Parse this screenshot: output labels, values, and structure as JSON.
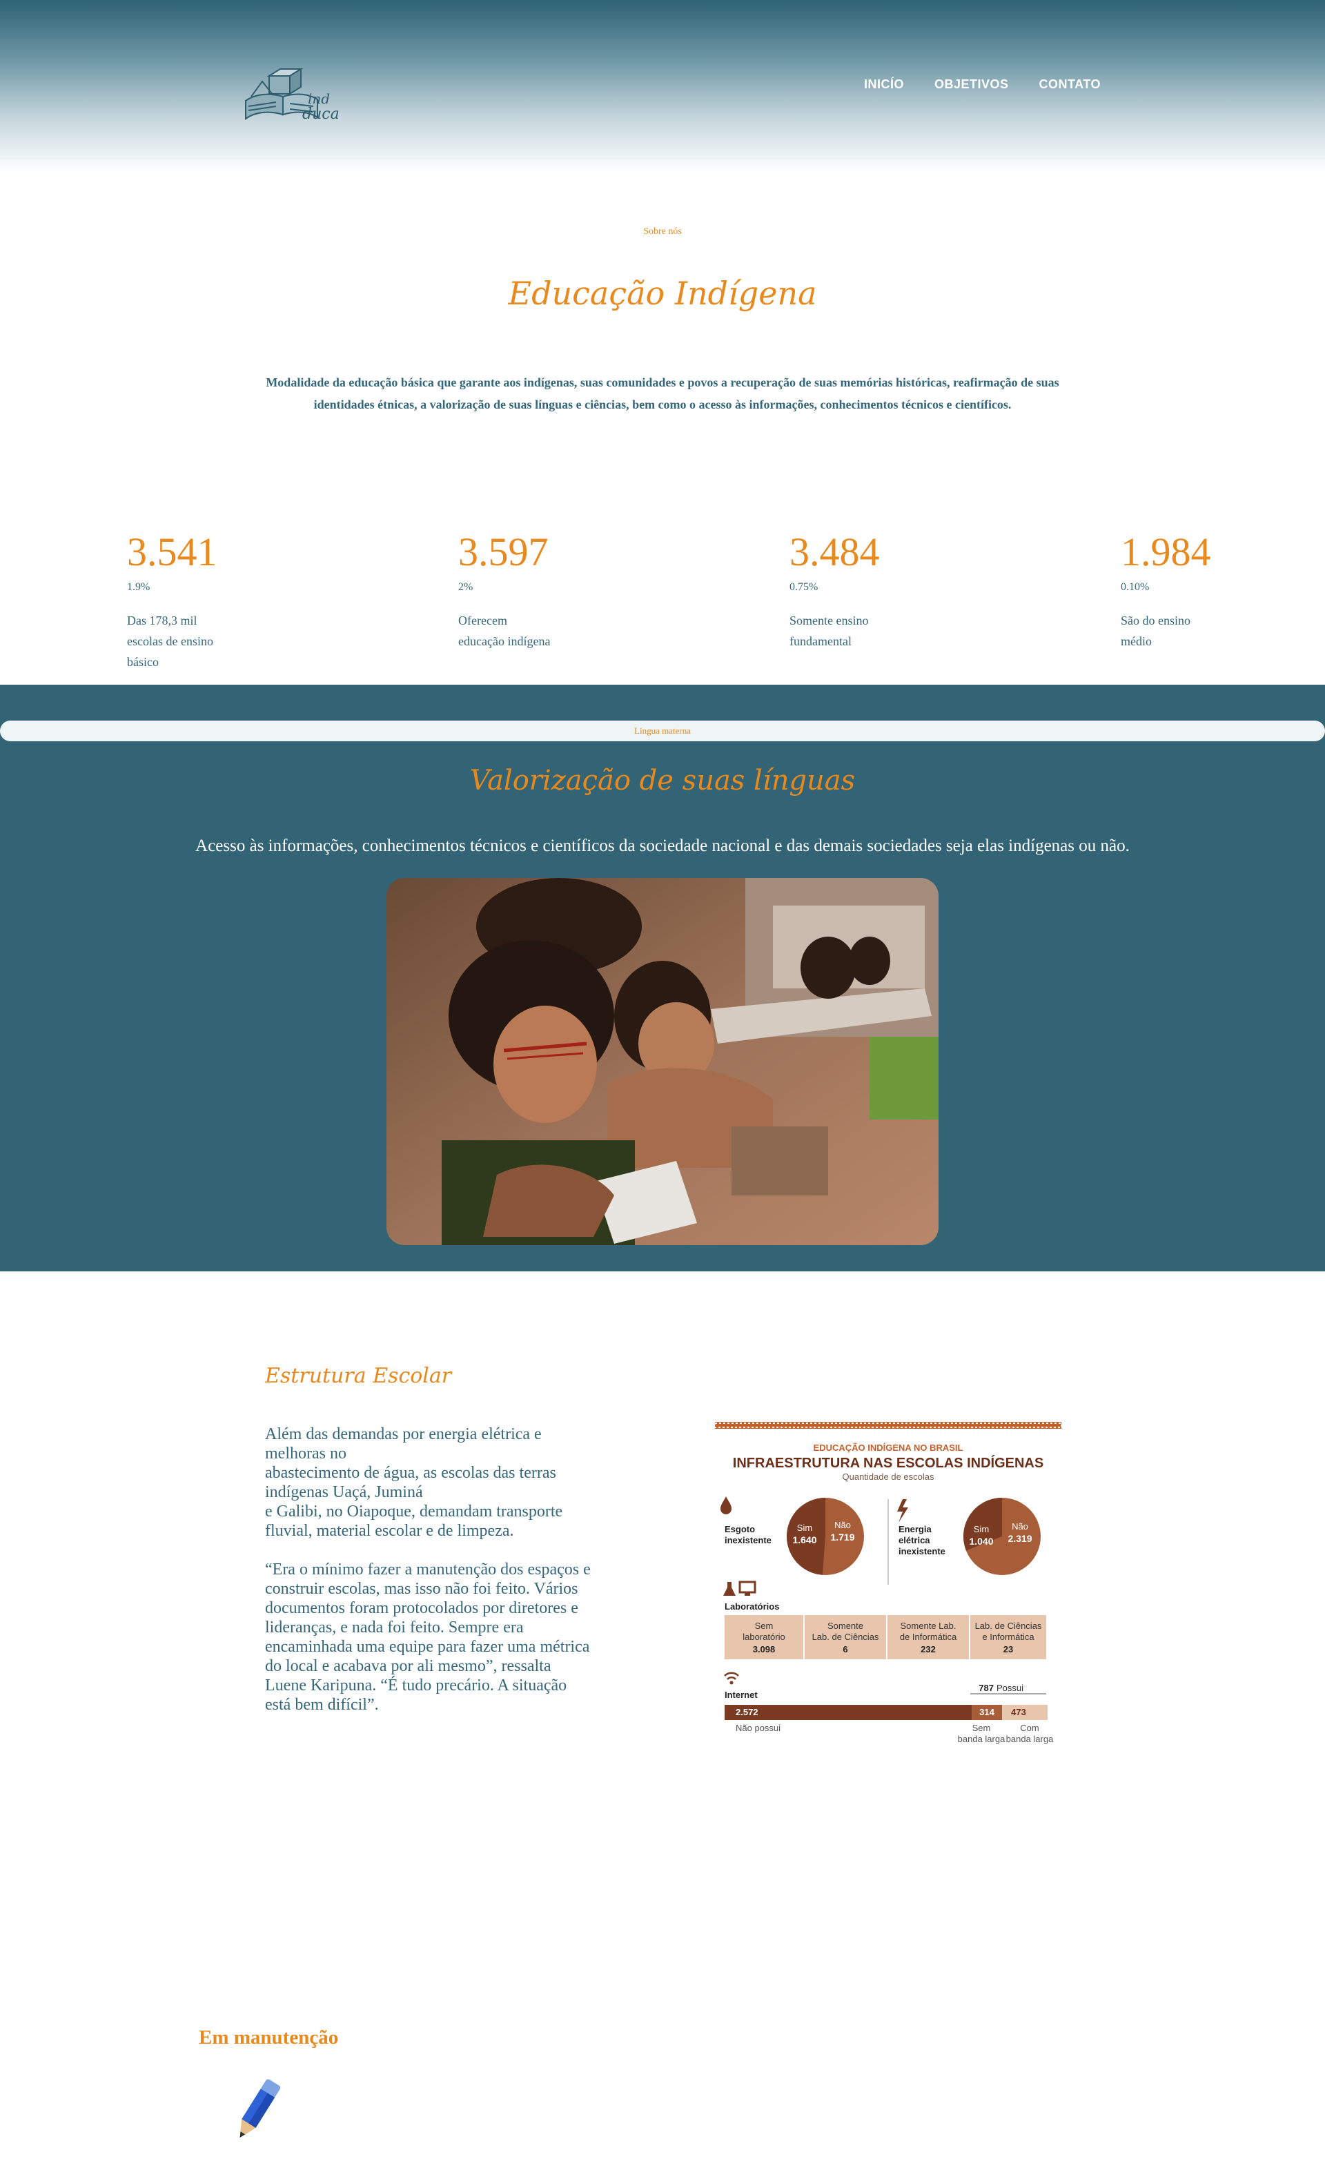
{
  "header": {
    "logo_text": "indeduca",
    "nav": [
      {
        "label": "INICÍO"
      },
      {
        "label": "OBJETIVOS"
      },
      {
        "label": "CONTATO"
      }
    ]
  },
  "about": {
    "eyebrow": "Sobre nós",
    "title": "Educação Indígena",
    "text_line1": "Modalidade da educação básica que garante aos indígenas, suas comunidades e povos a recuperação de suas memórias históricas, reafirmação de suas",
    "text_line2": "identidades étnicas, a valorização de suas línguas e ciências, bem como o acesso às informações, conhecimentos técnicos e científicos."
  },
  "stats": [
    {
      "value": "3.541",
      "pct": "1.9%",
      "desc": [
        "Das 178,3 mil",
        "escolas de ensino",
        "básico"
      ]
    },
    {
      "value": "3.597",
      "pct": "2%",
      "desc": [
        "Oferecem",
        "educação indígena"
      ]
    },
    {
      "value": "3.484",
      "pct": "0.75%",
      "desc": [
        "Somente ensino",
        "fundamental"
      ]
    },
    {
      "value": "1.984",
      "pct": "0.10%",
      "desc": [
        "São do ensino",
        "médio"
      ]
    }
  ],
  "languages": {
    "eyebrow": "Língua materna",
    "title": "Valorização de suas línguas",
    "text": "Acesso às informações, conhecimentos técnicos e científicos da sociedade nacional e das demais sociedades seja elas indígenas ou não."
  },
  "structure": {
    "title": "Estrutura Escolar",
    "p1": [
      "Além das demandas por energia elétrica e",
      "melhoras no",
      "abastecimento de água, as escolas das terras",
      "indígenas Uaçá, Juminá",
      "e Galibi, no Oiapoque, demandam transporte",
      "fluvial, material escolar e de limpeza."
    ],
    "p2": [
      "“Era o mínimo fazer a manutenção dos espaços e",
      "construir escolas, mas isso não foi feito. Vários",
      "documentos foram protocolados por diretores e",
      "lideranças, e nada foi feito. Sempre era",
      "encaminhada uma equipe para fazer uma métrica",
      "do local e acabava por ali mesmo”, ressalta",
      "Luene Karipuna. “É tudo precário. A situação",
      "está bem difícil”."
    ]
  },
  "infographic": {
    "kicker": "EDUCAÇÃO INDÍGENA NO BRASIL",
    "title": "INFRAESTRUTURA NAS ESCOLAS INDÍGENAS",
    "subtitle": "Quantidade de escolas",
    "sewage": {
      "label1": "Esgoto",
      "label2": "inexistente",
      "yes_label": "Sim",
      "yes": "1.640",
      "no_label": "Não",
      "no": "1.719",
      "yes_value": 1640,
      "no_value": 1719
    },
    "energy": {
      "label1": "Energia",
      "label2": "elétrica",
      "label3": "inexistente",
      "yes_label": "Sim",
      "yes": "1.040",
      "no_label": "Não",
      "no": "2.319",
      "yes_value": 1040,
      "no_value": 2319
    },
    "labs": {
      "title": "Laboratórios",
      "cells": [
        {
          "l1": "Sem",
          "l2": "laboratório",
          "v": "3.098"
        },
        {
          "l1": "Somente",
          "l2": "Lab. de Ciências",
          "v": "6"
        },
        {
          "l1": "Somente Lab.",
          "l2": "de Informática",
          "v": "232"
        },
        {
          "l1": "Lab. de Ciências",
          "l2": "e Informática",
          "v": "23"
        }
      ]
    },
    "internet": {
      "title": "Internet",
      "has_value": "787",
      "has_label": "Possui",
      "none_value": "2.572",
      "none_label": "Não possui",
      "slow_value": "314",
      "slow_l1": "Sem",
      "slow_l2": "banda larga",
      "fast_value": "473",
      "fast_l1": "Com",
      "fast_l2": "banda larga",
      "none_count": 2572,
      "slow_count": 314,
      "fast_count": 473
    },
    "colors": {
      "dark": "#7a3b22",
      "mid": "#a75d37",
      "light": "#e8c6ad",
      "accent": "#c8602c",
      "title": "#6b2e18"
    }
  },
  "maintenance": {
    "label": "Em manutenção"
  }
}
